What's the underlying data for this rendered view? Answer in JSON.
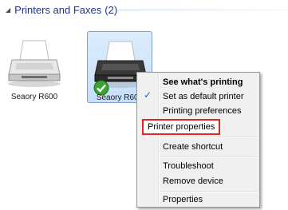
{
  "group": {
    "title": "Printers and Faxes",
    "count": "(2)"
  },
  "printers": [
    {
      "label": "Seaory R600"
    },
    {
      "label": "Seaory R600"
    }
  ],
  "menu": {
    "items": [
      {
        "label": "See what's printing"
      },
      {
        "label": "Set as default printer"
      },
      {
        "label": "Printing preferences"
      },
      {
        "label": "Printer properties"
      },
      {
        "label": "Create shortcut"
      },
      {
        "label": "Troubleshoot"
      },
      {
        "label": "Remove device"
      },
      {
        "label": "Properties"
      }
    ],
    "checked_item": "Set as default printer",
    "highlighted_item": "Printer properties"
  },
  "colors": {
    "group_header": "#1e3287",
    "highlight_border": "#e0281e",
    "selection_fill": "#cfe4fb",
    "check_green": "#3aa335"
  }
}
